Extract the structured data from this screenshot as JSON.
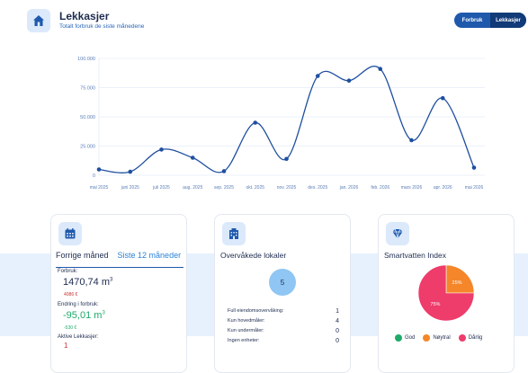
{
  "header": {
    "title": "Lekkasjer",
    "subtitle": "Totalt forbruk de siste månedene"
  },
  "toggle": {
    "options": [
      "Forbruk",
      "Lekkasjer"
    ],
    "active": "Lekkasjer"
  },
  "chart_data": {
    "type": "line",
    "categories": [
      "mai 2025",
      "juni 2025",
      "juli 2025",
      "aug. 2025",
      "sep. 2025",
      "okt. 2025",
      "nov. 2025",
      "des. 2025",
      "jan. 2026",
      "feb. 2026",
      "mars 2026",
      "apr. 2026",
      "mai 2026"
    ],
    "series": [
      {
        "values": [
          5000,
          3000,
          22000,
          15000,
          3500,
          45000,
          14000,
          85000,
          81000,
          91000,
          30000,
          66000,
          6500
        ]
      }
    ],
    "yticks": [
      "100.000",
      "75.000",
      "50.000",
      "25.000",
      "0"
    ],
    "ylim": [
      0,
      100000
    ],
    "grid": true,
    "color": "#1f4fa0"
  },
  "card1": {
    "tab_active": "Forrige måned",
    "tab_other": "Siste 12 måneder",
    "consumption_label": "Forbruk:",
    "consumption_value": "1470,74",
    "consumption_unit": "m",
    "consumption_sup": "3",
    "consumption_cost": "4086 €",
    "change_label": "Endring i forbruk:",
    "change_value": "-95,01",
    "change_unit": "m",
    "change_sup": "3",
    "change_cost": "-530 €",
    "leaks_label": "Aktive Lekkasjer:",
    "leaks_value": "1"
  },
  "card2": {
    "title": "Overvåkede lokaler",
    "total": "5",
    "rows": [
      {
        "label": "Full eiendomsovervåking:",
        "value": "1"
      },
      {
        "label": "Kun hovedmåler:",
        "value": "4"
      },
      {
        "label": "Kun undermåler:",
        "value": "0"
      },
      {
        "label": "Ingen enheter:",
        "value": "0"
      }
    ]
  },
  "card3": {
    "title": "Smartvatten Index",
    "pie": [
      {
        "label": "God",
        "value": 0,
        "color": "#1eaa6a"
      },
      {
        "label": "Nøytral",
        "value": 25,
        "color": "#f5862a"
      },
      {
        "label": "Dårlig",
        "value": 75,
        "color": "#ee3c6b"
      }
    ],
    "slice_labels": [
      "25%",
      "75%"
    ]
  },
  "colors": {
    "accent": "#1f59ac",
    "positive": "#1eaa6a",
    "negative": "#c83030"
  }
}
